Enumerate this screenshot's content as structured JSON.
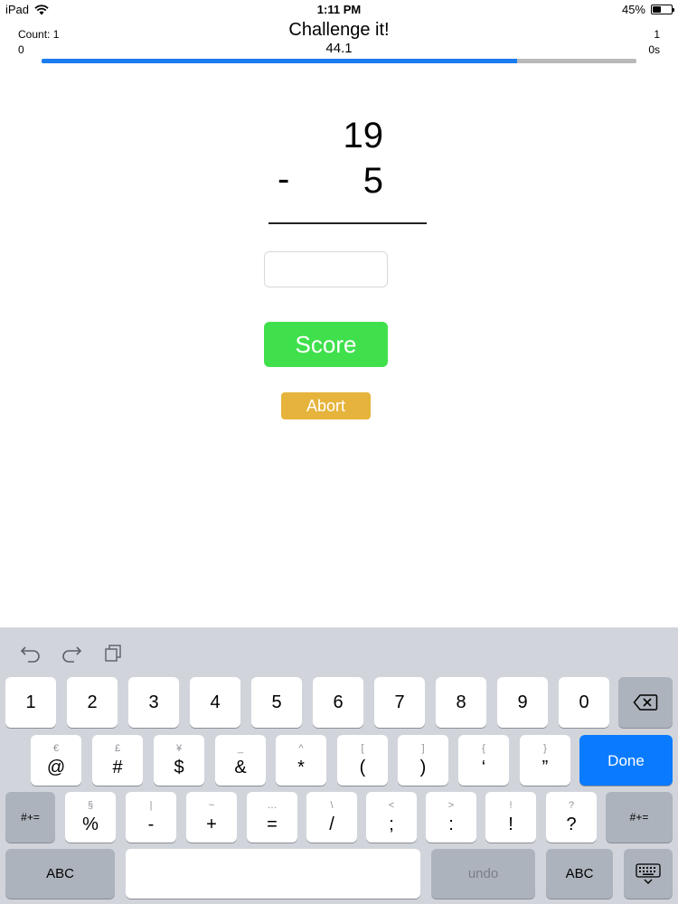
{
  "status_bar": {
    "device": "iPad",
    "time": "1:11 PM",
    "battery": "45%",
    "battery_level": 0.45
  },
  "header": {
    "count_label": "Count: 1",
    "min_label": "0",
    "title": "Challenge it!",
    "value_label": "44.1",
    "max_label": "1",
    "time_label": "0s",
    "progress": 0.8
  },
  "problem": {
    "top_operand": "19",
    "operator": "-",
    "bottom_operand": "5"
  },
  "answer": {
    "value": "",
    "placeholder": ""
  },
  "buttons": {
    "score_label": "Score",
    "abort_label": "Abort"
  },
  "colors": {
    "progress": "#1b7cf0",
    "score": "#3fe04c",
    "abort": "#e6b43c",
    "done": "#0a7bff"
  },
  "keyboard": {
    "row1": [
      "1",
      "2",
      "3",
      "4",
      "5",
      "6",
      "7",
      "8",
      "9",
      "0"
    ],
    "row2": [
      {
        "sub": "€",
        "main": "@"
      },
      {
        "sub": "£",
        "main": "#"
      },
      {
        "sub": "¥",
        "main": "$"
      },
      {
        "sub": "_",
        "main": "&"
      },
      {
        "sub": "^",
        "main": "*"
      },
      {
        "sub": "[",
        "main": "("
      },
      {
        "sub": "]",
        "main": ")"
      },
      {
        "sub": "{",
        "main": "‘"
      },
      {
        "sub": "}",
        "main": "”"
      }
    ],
    "row3": [
      {
        "sub": "§",
        "main": "%"
      },
      {
        "sub": "|",
        "main": "-"
      },
      {
        "sub": "~",
        "main": "+"
      },
      {
        "sub": "…",
        "main": "="
      },
      {
        "sub": "\\",
        "main": "/"
      },
      {
        "sub": "<",
        "main": ";"
      },
      {
        "sub": ">",
        "main": ":"
      },
      {
        "sub": "!",
        "main": "!"
      },
      {
        "sub": "?",
        "main": "?"
      }
    ],
    "shift_label": "#+=",
    "done_label": "Done",
    "abc_label": "ABC",
    "undo_label": "undo",
    "icons": [
      "undo-icon",
      "redo-icon",
      "paste-icon",
      "backspace-icon",
      "keyboard-dismiss-icon"
    ]
  }
}
